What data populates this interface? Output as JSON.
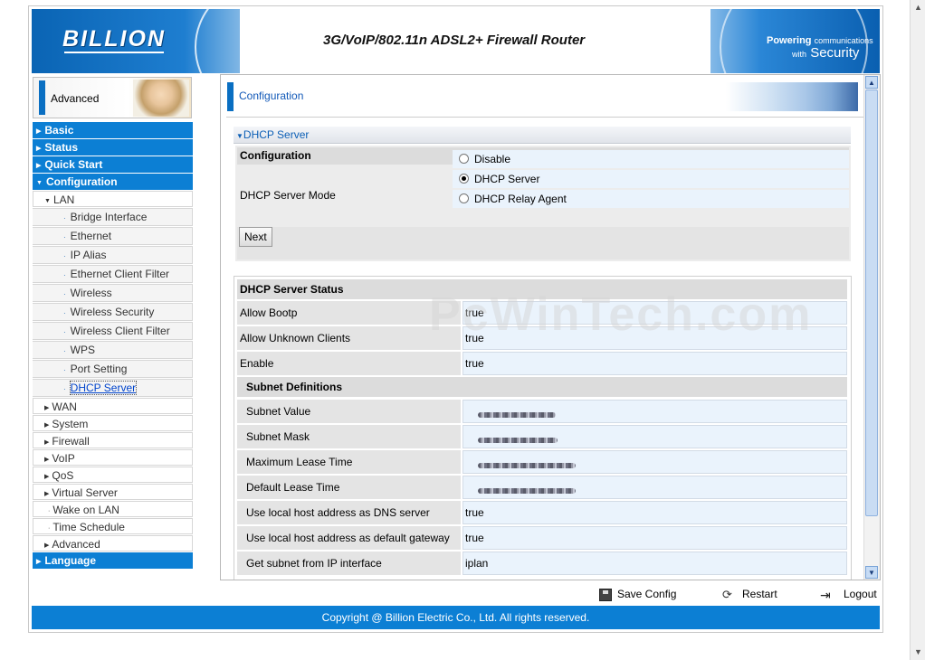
{
  "header": {
    "brand": "BILLION",
    "product_title": "3G/VoIP/802.11n ADSL2+ Firewall Router",
    "tagline_bold": "Powering",
    "tagline_small": "communications",
    "tagline_with": "with",
    "tagline_big": "Security"
  },
  "sidebar": {
    "mode_label": "Advanced",
    "items": [
      {
        "label": "Basic",
        "level": 1,
        "expanded": false
      },
      {
        "label": "Status",
        "level": 1,
        "expanded": false
      },
      {
        "label": "Quick Start",
        "level": 1,
        "expanded": false
      },
      {
        "label": "Configuration",
        "level": 1,
        "expanded": true
      },
      {
        "label": "LAN",
        "level": 2,
        "expanded": true
      },
      {
        "label": "Bridge Interface",
        "level": 3
      },
      {
        "label": "Ethernet",
        "level": 3
      },
      {
        "label": "IP Alias",
        "level": 3
      },
      {
        "label": "Ethernet Client Filter",
        "level": 3
      },
      {
        "label": "Wireless",
        "level": 3
      },
      {
        "label": "Wireless Security",
        "level": 3
      },
      {
        "label": "Wireless Client Filter",
        "level": 3
      },
      {
        "label": "WPS",
        "level": 3
      },
      {
        "label": "Port Setting",
        "level": 3
      },
      {
        "label": "DHCP Server",
        "level": 3,
        "active": true
      },
      {
        "label": "WAN",
        "level": 2
      },
      {
        "label": "System",
        "level": 2
      },
      {
        "label": "Firewall",
        "level": 2
      },
      {
        "label": "VoIP",
        "level": 2
      },
      {
        "label": "QoS",
        "level": 2
      },
      {
        "label": "Virtual Server",
        "level": 2
      },
      {
        "label": "Wake on LAN",
        "level": 2,
        "no_arrow": true
      },
      {
        "label": "Time Schedule",
        "level": 2,
        "no_arrow": true
      },
      {
        "label": "Advanced",
        "level": 2
      },
      {
        "label": "Language",
        "level": 1
      }
    ]
  },
  "main": {
    "page_title": "Configuration",
    "section_title": "DHCP Server",
    "config": {
      "heading": "Configuration",
      "mode_label": "DHCP Server Mode",
      "options": [
        "Disable",
        "DHCP Server",
        "DHCP Relay Agent"
      ],
      "selected": "DHCP Server",
      "next_label": "Next"
    },
    "status": {
      "heading": "DHCP Server Status",
      "rows_top": [
        {
          "k": "Allow Bootp",
          "v": "true"
        },
        {
          "k": "Allow Unknown Clients",
          "v": "true"
        },
        {
          "k": "Enable",
          "v": "true"
        }
      ],
      "subnet_heading": "Subnet Definitions",
      "rows_subnet": [
        {
          "k": "Subnet Value",
          "v": ""
        },
        {
          "k": "Subnet Mask",
          "v": ""
        },
        {
          "k": "Maximum Lease Time",
          "v": ""
        },
        {
          "k": "Default Lease Time",
          "v": ""
        },
        {
          "k": "Use local host address as DNS server",
          "v": "true"
        },
        {
          "k": "Use local host address as default gateway",
          "v": "true"
        },
        {
          "k": "Get subnet from IP interface",
          "v": "iplan"
        }
      ]
    }
  },
  "actions": {
    "save": "Save Config",
    "restart": "Restart",
    "logout": "Logout"
  },
  "footer": {
    "copyright": "Copyright @ Billion Electric Co., Ltd. All rights reserved."
  },
  "watermark": "PcWinTech.com",
  "colors": {
    "nav_blue": "#0c7fd4",
    "title_blue": "#1259b8",
    "value_bg": "#eaf3fc"
  }
}
